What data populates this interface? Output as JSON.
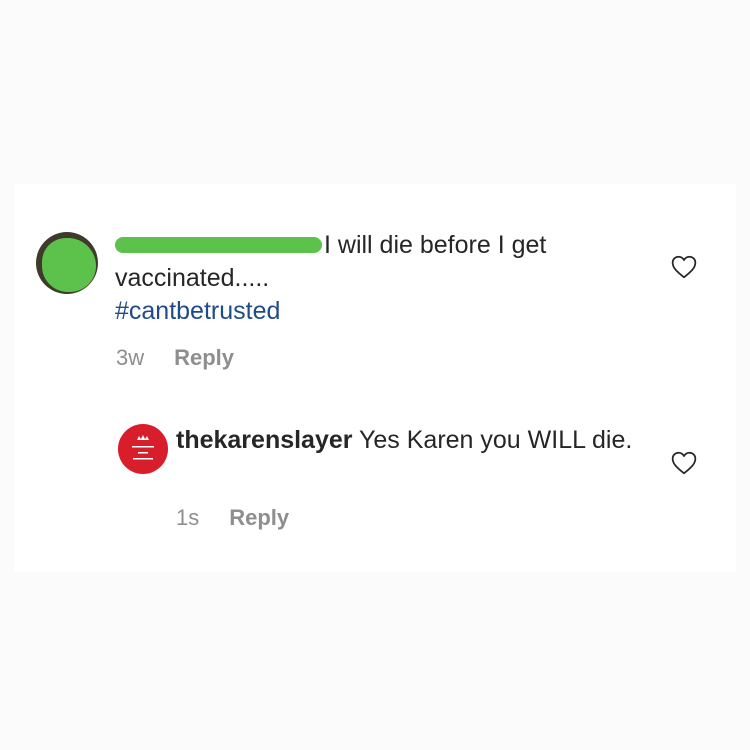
{
  "comment": {
    "text_line1": "I will die before I get",
    "text_line2": "vaccinated.....",
    "hashtag": "#cantbetrusted",
    "time": "3w",
    "reply_label": "Reply"
  },
  "reply": {
    "username": "thekarenslayer",
    "text": "Yes Karen you WILL die.",
    "time": "1s",
    "reply_label": "Reply"
  },
  "icons": {
    "like": "heart-outline-icon"
  },
  "colors": {
    "text": "#262626",
    "secondary": "#8e8e8e",
    "hashtag": "#1f4b88",
    "redaction": "#5dc24b",
    "reply_avatar": "#d81e2a"
  }
}
